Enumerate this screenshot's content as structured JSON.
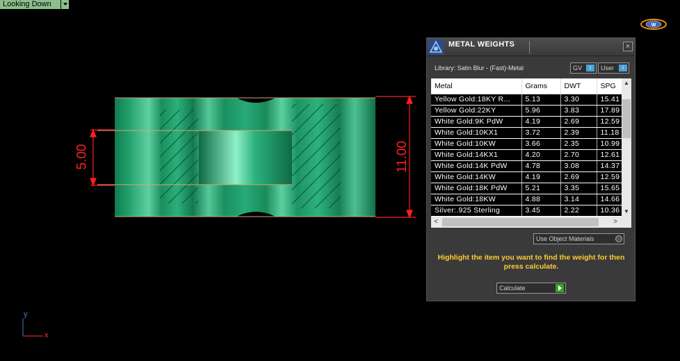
{
  "viewport": {
    "label": "Looking Down"
  },
  "dimensions": {
    "inner_height": "5.00",
    "outer_height": "11.00"
  },
  "axis": {
    "x": "x",
    "y": "y"
  },
  "panel": {
    "title": "METAL WEIGHTS",
    "close": "×",
    "library": "Library: Satin Blur - (Fast)-Metal",
    "toggle_gv": "GV",
    "toggle_user": "User",
    "columns": [
      "Metal",
      "Grams",
      "DWT",
      "SPG"
    ],
    "rows": [
      [
        "Yellow Gold:18KY R...",
        "5.13",
        "3.30",
        "15.41"
      ],
      [
        "Yellow Gold:22KY",
        "5.96",
        "3.83",
        "17.89"
      ],
      [
        "White Gold:9K PdW",
        "4.19",
        "2.69",
        "12.59"
      ],
      [
        "White Gold:10KX1",
        "3.72",
        "2.39",
        "11.18"
      ],
      [
        "White Gold:10KW",
        "3.66",
        "2.35",
        "10.99"
      ],
      [
        "White Gold:14KX1",
        "4.20",
        "2.70",
        "12.61"
      ],
      [
        "White Gold:14K PdW",
        "4.78",
        "3.08",
        "14.37"
      ],
      [
        "White Gold:14KW",
        "4.19",
        "2.69",
        "12.59"
      ],
      [
        "White Gold:18K PdW",
        "5.21",
        "3.35",
        "15.65"
      ],
      [
        "White Gold:18KW",
        "4.88",
        "3.14",
        "14.66"
      ],
      [
        "Silver:.925 Sterling",
        "3.45",
        "2.22",
        "10.36"
      ]
    ],
    "use_object_materials": "Use Object Materials",
    "instructions": "Highlight the item you want to find the weight for then press calculate.",
    "calculate": "Calculate"
  },
  "colors": {
    "ring": "#1fa36e",
    "dimension": "#ff1f1f",
    "instruction_text": "#ffcc33"
  }
}
